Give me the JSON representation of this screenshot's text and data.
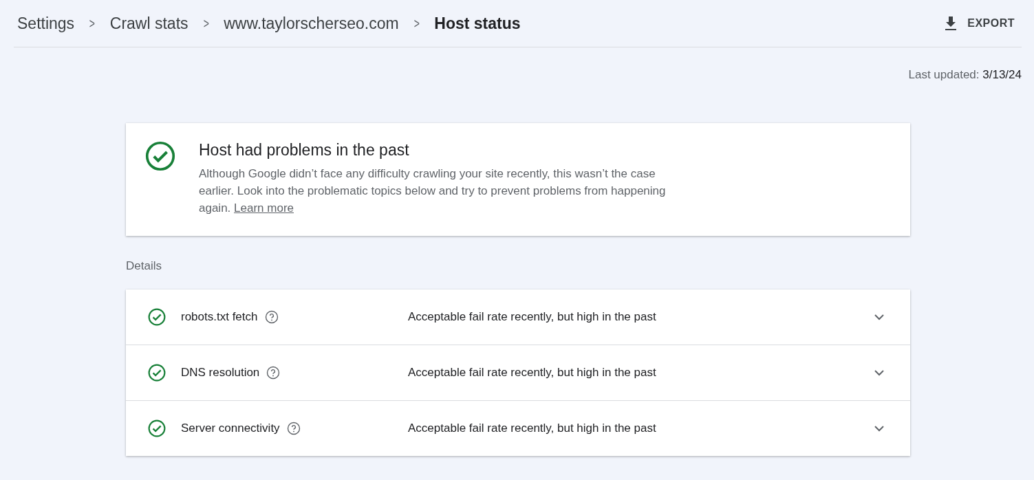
{
  "breadcrumbs": [
    {
      "label": "Settings",
      "current": false
    },
    {
      "label": "Crawl stats",
      "current": false
    },
    {
      "label": "www.taylorscherseo.com",
      "current": false
    },
    {
      "label": "Host status",
      "current": true
    }
  ],
  "breadcrumb_separator": ">",
  "export_button": {
    "label": "EXPORT"
  },
  "last_updated": {
    "label": "Last updated:",
    "value": "3/13/24"
  },
  "summary": {
    "passed": true,
    "title": "Host had problems in the past",
    "description": "Although Google didn’t face any difficulty crawling your site recently, this wasn’t the case earlier. Look into the problematic topics below and try to prevent problems from happening again.",
    "link": "Learn more"
  },
  "details_label": "Details",
  "details": [
    {
      "name": "robots.txt fetch",
      "passed": true,
      "message": "Acceptable fail rate recently, but high in the past",
      "expanded": false
    },
    {
      "name": "DNS resolution",
      "passed": true,
      "message": "Acceptable fail rate recently, but high in the past",
      "expanded": false
    },
    {
      "name": "Server connectivity",
      "passed": true,
      "message": "Acceptable fail rate recently, but high in the past",
      "expanded": false
    }
  ]
}
